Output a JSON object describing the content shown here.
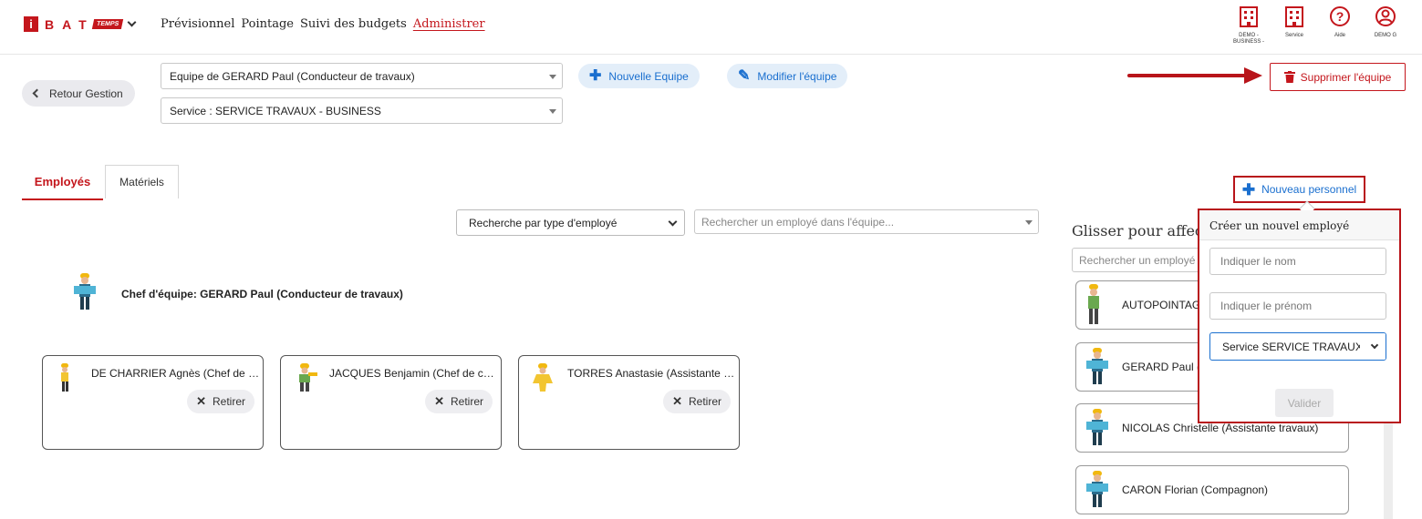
{
  "app": {
    "logo_i": "i",
    "logo_letters": "BAT",
    "logo_badge": "TEMPS"
  },
  "menu": {
    "items": [
      "Prévisionnel",
      "Pointage",
      "Suivi des budgets",
      "Administrer"
    ],
    "active": "Administrer"
  },
  "top_icons": [
    {
      "icon": "building-icon",
      "label": "DEMO - BUSINESS -"
    },
    {
      "icon": "building-icon",
      "label": "Service"
    },
    {
      "icon": "help-icon",
      "label": "Aide"
    },
    {
      "icon": "user-icon",
      "label": "DEMO G"
    }
  ],
  "toolbar": {
    "back_label": "Retour Gestion",
    "team_select": "Equipe de GERARD Paul (Conducteur de travaux)",
    "service_select": "Service : SERVICE TRAVAUX - BUSINESS",
    "new_team_label": "Nouvelle Equipe",
    "edit_team_label": "Modifier l'équipe",
    "delete_team_label": "Supprimer l'équipe"
  },
  "tabs": {
    "employees": "Employés",
    "materials": "Matériels"
  },
  "filters": {
    "type_select": "Recherche par type d'employé",
    "team_search_placeholder": "Rechercher un employé dans l'équipe..."
  },
  "chef": {
    "label": "Chef d'équipe: GERARD Paul (Conducteur de travaux)"
  },
  "team_members": [
    {
      "name": "DE CHARRIER Agnès (Chef de chantier)",
      "action": "Retirer"
    },
    {
      "name": "JACQUES Benjamin (Chef de chantier)",
      "action": "Retirer"
    },
    {
      "name": "TORRES Anastasie (Assistante travaux)",
      "action": "Retirer"
    }
  ],
  "side_panel": {
    "title": "Glisser pour affecter",
    "search_placeholder": "Rechercher un employé",
    "new_staff_label": "Nouveau personnel",
    "employees": [
      "AUTOPOINTAGE B",
      "GERARD Paul (",
      "NICOLAS Christelle (Assistante travaux)",
      "CARON Florian (Compagnon)"
    ]
  },
  "new_employee_popup": {
    "title": "Créer un nouvel employé",
    "lastname_placeholder": "Indiquer le nom",
    "firstname_placeholder": "Indiquer le prénom",
    "service_select": "Service SERVICE TRAVAUX",
    "submit_label": "Valider"
  },
  "colors": {
    "brand": "#c4161c",
    "link": "#1a6fcf",
    "highlight": "#b8141a"
  }
}
